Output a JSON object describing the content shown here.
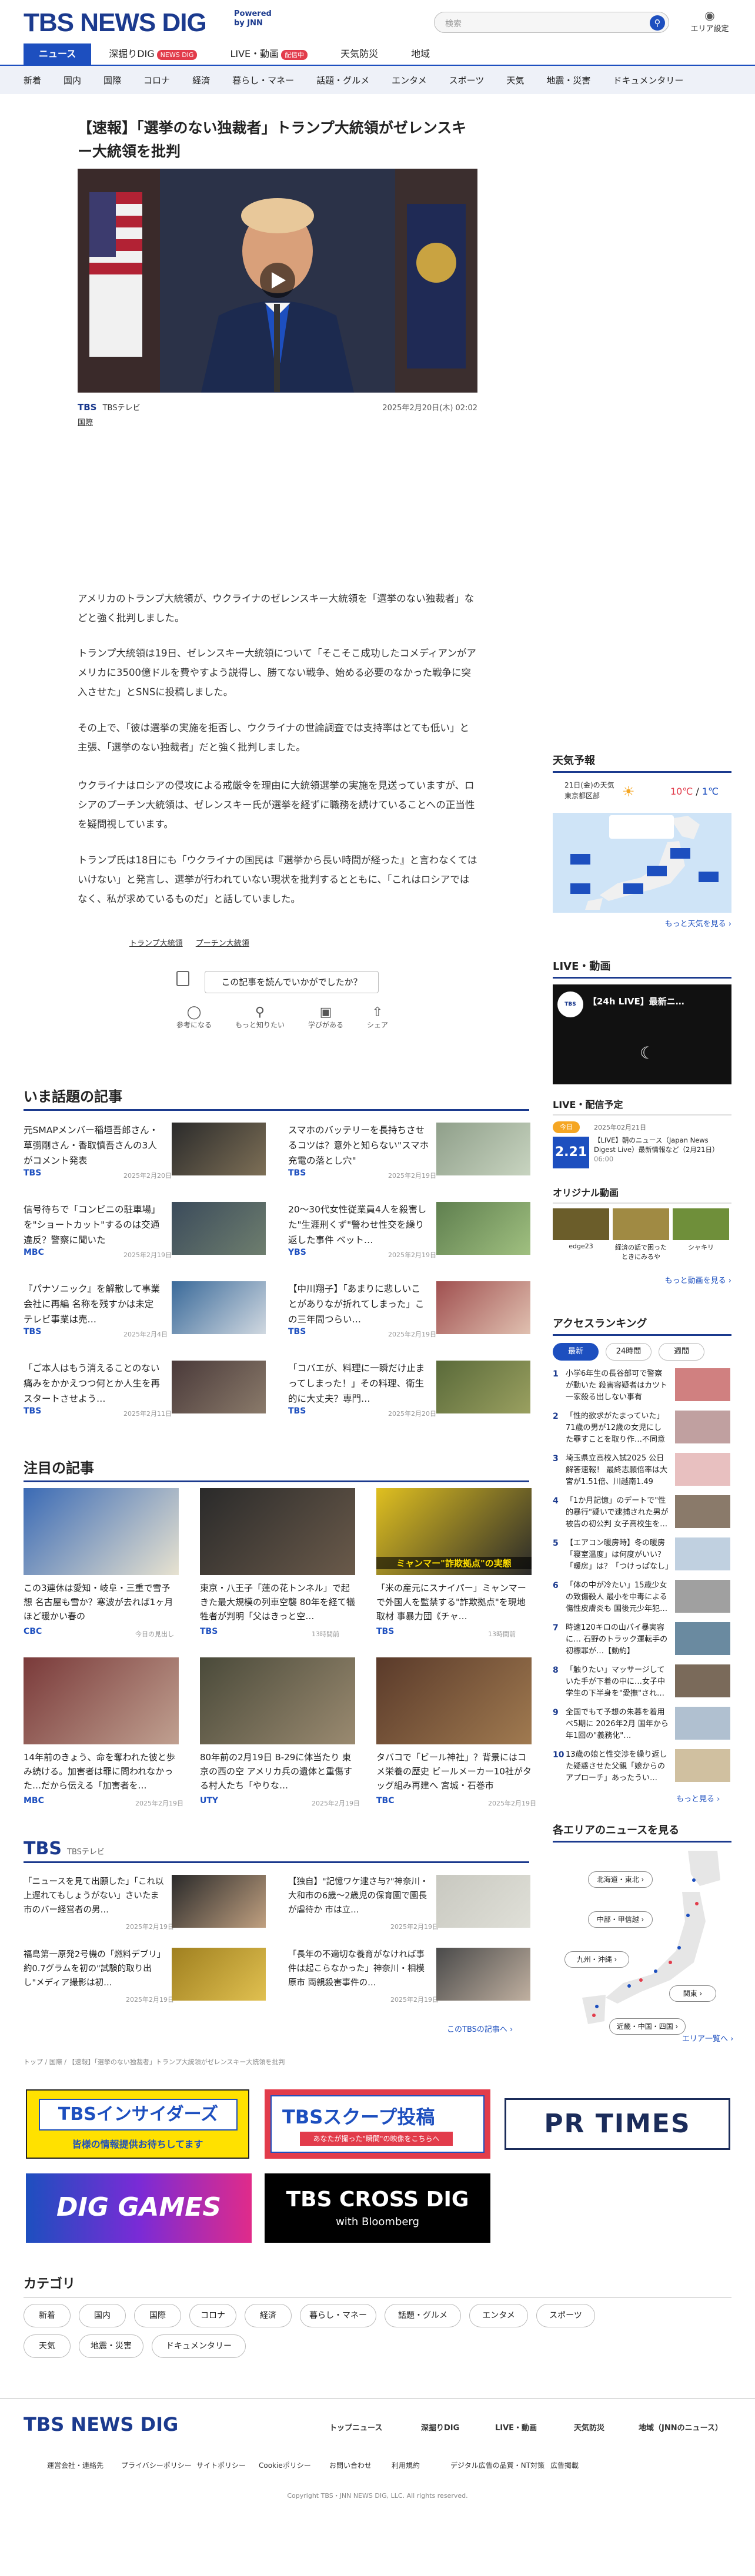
{
  "header": {
    "logo": "TBS NEWS DIG",
    "powered_line1": "Powered",
    "powered_line2": "by JNN",
    "search_placeholder": "検索",
    "area_setting": "エリア設定",
    "tabs": [
      {
        "label": "ニュース",
        "active": true
      },
      {
        "label": "深掘りDIG",
        "badge": "NEWS DIG"
      },
      {
        "label": "LIVE・動画",
        "badge": "配信中"
      },
      {
        "label": "天気防災"
      },
      {
        "label": "地域"
      }
    ],
    "categories": [
      "新着",
      "国内",
      "国際",
      "コロナ",
      "経済",
      "暮らし・マネー",
      "話題・グルメ",
      "エンタメ",
      "スポーツ",
      "天気",
      "地震・災害",
      "ドキュメンタリー"
    ]
  },
  "article": {
    "headline": "【速報】「選挙のない独裁者」トランプ大統領がゼレンスキー大統領を批判",
    "source_logo": "TBS",
    "source_name": "TBSテレビ",
    "category": "国際",
    "datetime": "2025年2月20日(木) 02:02",
    "paragraphs": [
      "アメリカのトランプ大統領が、ウクライナのゼレンスキー大統領を「選挙のない独裁者」などと強く批判しました。",
      "トランプ大統領は19日、ゼレンスキー大統領について「そこそこ成功したコメディアンがアメリカに3500億ドルを費やすよう説得し、勝てない戦争、始める必要のなかった戦争に突入させた」とSNSに投稿しました。",
      "その上で、「彼は選挙の実施を拒否し、ウクライナの世論調査では支持率はとても低い」と主張、「選挙のない独裁者」だと強く批判しました。",
      "ウクライナはロシアの侵攻による戒厳令を理由に大統領選挙の実施を見送っていますが、ロシアのプーチン大統領は、ゼレンスキー氏が選挙を経ずに職務を続けていることへの正当性を疑問視しています。",
      "トランプ氏は18日にも「ウクライナの国民は『選挙から長い時間が経った』と言わなくてはいけない」と発言し、選挙が行われていない現状を批判するとともに、「これはロシアではなく、私が求めているものだ」と話していました。"
    ],
    "tags": [
      "トランプ大統領",
      "プーチン大統領"
    ],
    "feedback_question": "この記事を読んでいかがでしたか？",
    "feedback_options": [
      "参考になる",
      "もっと知りたい",
      "学びがある",
      "シェア"
    ]
  },
  "topics": {
    "title": "いま話題の記事",
    "items": [
      {
        "text": "元SMAPメンバー稲垣吾郎さん・草彅剛さん・香取慎吾さんの3人がコメント発表",
        "src": "TBS",
        "date": "2025年2月20日"
      },
      {
        "text": "スマホのバッテリーを長持ちさせるコツは？意外と知らない\"スマホ充電の落とし穴\"",
        "src": "TBS",
        "date": "2025年2月19日"
      },
      {
        "text": "信号待ちで「コンビニの駐車場」を\"ショートカット\"するのは交通違反？警察に聞いた",
        "src": "MBC",
        "date": "2025年2月19日"
      },
      {
        "text": "20〜30代女性従業員4人を殺害した\"生涯刑くず\"警わせ性交を繰り返した事件 ベット…",
        "src": "YBS",
        "date": "2025年2月19日"
      },
      {
        "text": "『パナソニック』を解散して事業会社に再編 名称を残すかは未定 テレビ事業は売…",
        "src": "TBS",
        "date": "2025年2月4日"
      },
      {
        "text": "【中川翔子】「あまりに悲しいことがありなが折れてしまった」この三年間つらい…",
        "src": "TBS",
        "date": "2025年2月19日"
      },
      {
        "text": "「ご本人はもう消えることのない痛みをかかえつつ何とか人生を再スタートさせよう…",
        "src": "TBS",
        "date": "2025年2月11日"
      },
      {
        "text": "「コバエが、料理に一瞬だけ止まってしまった！」その料理、衛生的に大丈夫？専門…",
        "src": "TBS",
        "date": "2025年2月20日"
      }
    ]
  },
  "featured": {
    "title": "注目の記事",
    "items": [
      {
        "text": "この3連休は愛知・岐阜・三重で雪予想 名古屋も雪か？寒波が去れば1ヶ月ほど暖かい春の",
        "src": "CBC",
        "date": "今日の見出し"
      },
      {
        "text": "東京・八王子「蓮の花トンネル」で起きた最大規模の列車空襲 80年を経て犠牲者が判明「父はきっと空…",
        "src": "TBS",
        "date": "13時間前"
      },
      {
        "text": "「米の産元にスナイパー」ミャンマーで外国人を監禁する\"詐欺拠点\"を現地取材 事暴力団《チャ…",
        "src": "TBS",
        "date": "13時間前"
      },
      {
        "text": "14年前のきょう、命を奪われた彼と歩み続ける。加害者は罪に問われなかった…だから伝える「加害者を…",
        "src": "MBC",
        "date": "2025年2月19日"
      },
      {
        "text": "80年前の2月19日 B-29に体当たり 東京の西の空 アメリカ兵の遺体と重傷する村人たち「やりな…",
        "src": "UTY",
        "date": "2025年2月19日"
      },
      {
        "text": "タバコで「ビール神社」？背景にはコメ栄養の歴史 ビールメーカー10社がタッグ組み再建へ 宮城・石巻市",
        "src": "TBC",
        "date": "2025年2月19日"
      }
    ],
    "thumb_caption": "ミャンマー\"詐欺拠点\"の実態"
  },
  "tbs_block": {
    "logo": "TBS",
    "sub": "TBSテレビ",
    "items": [
      {
        "text": "「ニュースを見て出願した」「これ以上遅れてもしょうがない」さいたま市のバー経営者の男…",
        "date": "2025年2月19日"
      },
      {
        "text": "【独自】\"記憶ワケ逮さ与?\"神奈川・大和市の6歳～2歳児の保育園で園長が虐待か 市は立…",
        "date": "2025年2月19日"
      },
      {
        "text": "福島第一原発2号機の「燃料デブリ」約0.7グラムを初の\"試験的取り出し\"メディア撮影は初…",
        "date": "2025年2月19日"
      },
      {
        "text": "「長年の不適切な養育がなければ事件は起こらなかった」神奈川・相模原市 両親殺害事件の…",
        "date": "2025年2月19日"
      }
    ],
    "more": "このTBSの記事へ ›"
  },
  "breadcrumb": "トップ / 国際 / 【速報】「選挙のない独裁者」トランプ大統領がゼレンスキー大統領を批判",
  "banners": {
    "insiders": "TBSインサイダーズ",
    "insiders_sub": "皆様の情報提供お待ちしてます",
    "scoop": "TBSスクープ投稿",
    "scoop_sub": "あなたが撮った\"瞬間\"の映像をこちらへ",
    "prtimes": "PR TIMES",
    "diggames": "DIG GAMES",
    "crossdig": "TBS CROSS DIG",
    "crossdig_sub": "with Bloomberg"
  },
  "categories_section": {
    "title": "カテゴリ",
    "items": [
      "新着",
      "国内",
      "国際",
      "コロナ",
      "経済",
      "暮らし・マネー",
      "話題・グルメ",
      "エンタメ",
      "スポーツ",
      "天気",
      "地震・災害",
      "ドキュメンタリー"
    ]
  },
  "footer": {
    "logo": "TBS NEWS DIG",
    "nav": [
      "トップニュース",
      "深掘りDIG",
      "LIVE・動画",
      "天気防災",
      "地域（JNNのニュース）"
    ],
    "links": [
      "運営会社・連絡先",
      "プライバシーポリシー",
      "サイトポリシー",
      "Cookieポリシー",
      "お問い合わせ",
      "利用規約",
      "デジタル広告の品質・NT対策",
      "広告掲載"
    ],
    "copyright": "Copyright TBS・JNN NEWS DIG, LLC. All rights reserved."
  },
  "sidebar": {
    "weather_title": "天気予報",
    "weather_date": "21日(金)の天気",
    "weather_region": "東京都区部",
    "weather_temp_high": "10℃",
    "weather_temp_low": "1℃",
    "weather_more": "もっと天気を見る ›",
    "live_title": "LIVE・動画",
    "live_video_title": "【24h LIVE】最新ニ…",
    "schedule_title": "LIVE・配信予定",
    "schedule_tab": "今日",
    "schedule_date": "2025年02月21日",
    "schedule_day": "2.21",
    "schedule_text": "【LIVE】朝のニュース（Japan News Digest Live）最新情報など（2月21日）",
    "schedule_time": "06:00",
    "original_title": "オリジナル動画",
    "original_items": [
      "edge23",
      "経済の話で困ったときにみるや",
      "シャキリ"
    ],
    "original_more": "もっと動画を見る ›",
    "ranking_title": "アクセスランキング",
    "ranking_tabs": [
      "最新",
      "24時間",
      "週間"
    ],
    "ranking": [
      "小学6年生の長谷部可で警察が動いた 殺害容疑者はカツト一家殺る出しない事有【DNA】",
      "「性的欲求がたまっていた」71歳の男が12歳の女児にした罪すことを取り作…不同意わい…",
      "埼玉県立高校入試2025 公日解答速報！ 最終志願倍率は大宮が1.51倍、川越南1.49倍、…",
      "「1か月記憶」のデートで\"性的暴行\"疑いで逮捕された男が被告の初公判 女子高校生を…",
      "【エアコン暖房時】冬の暖房「寝室温度」は何度がいい？「暖房」は？「つけっぱなし」か…",
      "「体の中が冷たい」15歳少女の致傷殺人 最小を中毒による傷性皮膚炎も 国後元少年犯…",
      "時速120キロの山パイ暴実容に… 石野のトラック運転手の初標罪が…【動約】",
      "「触りたい」マッサージしていた手が下着の中に…女子中学生の下半身を\"愛撫\"され…",
      "全国でもて予想の朱暮を着用ベ5期に 2026年2月 国年から年1回の\"義務化\"…",
      "13歳の娘と性交渉を繰り返した疑惑させた父親「娘からのアプローチ」あったうい…"
    ],
    "ranking_more": "もっと見る ›",
    "area_title": "各エリアのニュースを見る",
    "area_buttons": [
      "北海道・東北 ›",
      "中部・甲信越 ›",
      "九州・沖縄 ›",
      "関東 ›",
      "近畿・中国・四国 ›"
    ],
    "area_more": "エリア一覧へ ›"
  },
  "colors": {
    "brand": "#1b3a8e",
    "accent": "#1d4fbf",
    "live": "#e23c4b"
  }
}
